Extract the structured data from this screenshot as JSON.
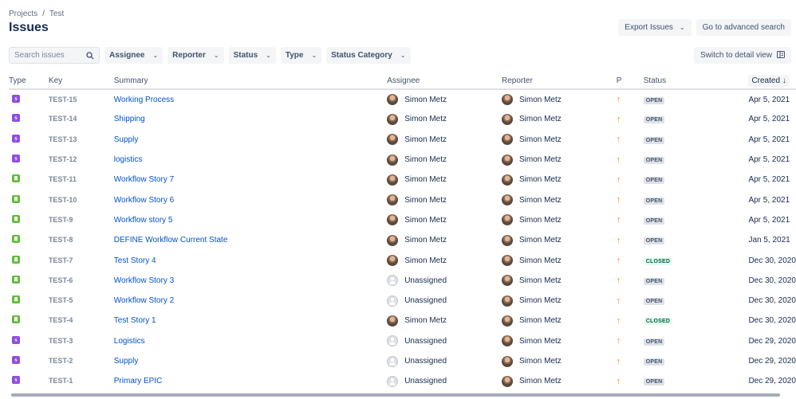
{
  "breadcrumb": {
    "projects": "Projects",
    "separator": "/",
    "project": "Test"
  },
  "title": "Issues",
  "actions": {
    "export": "Export Issues",
    "advanced": "Go to advanced search"
  },
  "filters": {
    "search_placeholder": "Search issues",
    "assignee": "Assignee",
    "reporter": "Reporter",
    "status": "Status",
    "type": "Type",
    "status_category": "Status Category"
  },
  "detail_view": "Switch to detail view",
  "columns": {
    "type": "Type",
    "key": "Key",
    "summary": "Summary",
    "assignee": "Assignee",
    "reporter": "Reporter",
    "p": "P",
    "status": "Status",
    "created": "Created"
  },
  "issues": [
    {
      "type": "epic",
      "key": "TEST-15",
      "summary": "Working Process",
      "assignee": "Simon Metz",
      "reporter": "Simon Metz",
      "status": "OPEN",
      "created": "Apr 5, 2021"
    },
    {
      "type": "epic",
      "key": "TEST-14",
      "summary": "Shipping",
      "assignee": "Simon Metz",
      "reporter": "Simon Metz",
      "status": "OPEN",
      "created": "Apr 5, 2021"
    },
    {
      "type": "epic",
      "key": "TEST-13",
      "summary": "Supply",
      "assignee": "Simon Metz",
      "reporter": "Simon Metz",
      "status": "OPEN",
      "created": "Apr 5, 2021"
    },
    {
      "type": "epic",
      "key": "TEST-12",
      "summary": "logistics",
      "assignee": "Simon Metz",
      "reporter": "Simon Metz",
      "status": "OPEN",
      "created": "Apr 5, 2021"
    },
    {
      "type": "story",
      "key": "TEST-11",
      "summary": "Workflow Story 7",
      "assignee": "Simon Metz",
      "reporter": "Simon Metz",
      "status": "OPEN",
      "created": "Apr 5, 2021"
    },
    {
      "type": "story",
      "key": "TEST-10",
      "summary": "Workflow Story 6",
      "assignee": "Simon Metz",
      "reporter": "Simon Metz",
      "status": "OPEN",
      "created": "Apr 5, 2021"
    },
    {
      "type": "story",
      "key": "TEST-9",
      "summary": "Workflow story 5",
      "assignee": "Simon Metz",
      "reporter": "Simon Metz",
      "status": "OPEN",
      "created": "Apr 5, 2021"
    },
    {
      "type": "story",
      "key": "TEST-8",
      "summary": "DEFINE Workflow Current State",
      "assignee": "Simon Metz",
      "reporter": "Simon Metz",
      "status": "OPEN",
      "created": "Jan 5, 2021"
    },
    {
      "type": "story",
      "key": "TEST-7",
      "summary": "Test Story 4",
      "assignee": "Simon Metz",
      "reporter": "Simon Metz",
      "status": "CLOSED",
      "created": "Dec 30, 2020"
    },
    {
      "type": "story",
      "key": "TEST-6",
      "summary": "Workflow Story 3",
      "assignee": "Unassigned",
      "reporter": "Simon Metz",
      "status": "OPEN",
      "created": "Dec 30, 2020"
    },
    {
      "type": "story",
      "key": "TEST-5",
      "summary": "Workflow Story 2",
      "assignee": "Unassigned",
      "reporter": "Simon Metz",
      "status": "OPEN",
      "created": "Dec 30, 2020"
    },
    {
      "type": "story",
      "key": "TEST-4",
      "summary": "Test Story 1",
      "assignee": "Simon Metz",
      "reporter": "Simon Metz",
      "status": "CLOSED",
      "created": "Dec 30, 2020"
    },
    {
      "type": "epic",
      "key": "TEST-3",
      "summary": "Logistics",
      "assignee": "Unassigned",
      "reporter": "Simon Metz",
      "status": "OPEN",
      "created": "Dec 29, 2020"
    },
    {
      "type": "epic",
      "key": "TEST-2",
      "summary": "Supply",
      "assignee": "Unassigned",
      "reporter": "Simon Metz",
      "status": "OPEN",
      "created": "Dec 29, 2020"
    },
    {
      "type": "epic",
      "key": "TEST-1",
      "summary": "Primary EPIC",
      "assignee": "Unassigned",
      "reporter": "Simon Metz",
      "status": "OPEN",
      "created": "Dec 29, 2020"
    }
  ]
}
